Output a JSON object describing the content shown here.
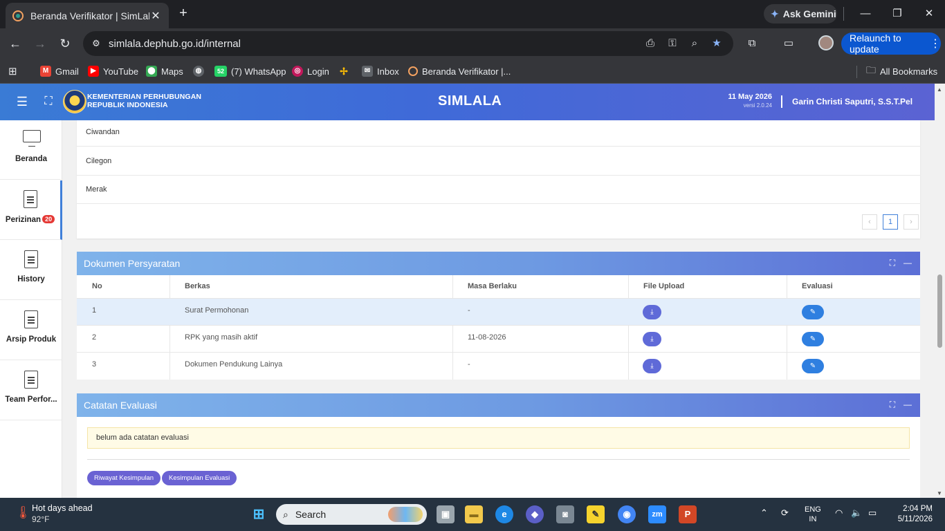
{
  "browser": {
    "tab_title": "Beranda Verifikator | SimLala",
    "url": "simlala.dephub.go.id/internal",
    "ask_gemini": "Ask Gemini",
    "relaunch": "Relaunch to update",
    "all_bookmarks": "All Bookmarks",
    "bookmarks": [
      {
        "label": "Gmail"
      },
      {
        "label": "YouTube"
      },
      {
        "label": "Maps"
      },
      {
        "label": ""
      },
      {
        "label": "(7) WhatsApp",
        "badge": "52"
      },
      {
        "label": "Login"
      },
      {
        "label": ""
      },
      {
        "label": "Inbox"
      },
      {
        "label": "Beranda Verifikator |..."
      }
    ]
  },
  "header": {
    "org_line1": "KEMENTERIAN PERHUBUNGAN",
    "org_line2": "REPUBLIK INDONESIA",
    "app_title": "SIMLALA",
    "date": "11 May 2026",
    "version": "versi 2.0.24",
    "user": "Garin Christi Saputri, S.S.T.Pel"
  },
  "sidebar": {
    "items": [
      {
        "label": "Beranda"
      },
      {
        "label": "Perizinan",
        "badge": "20"
      },
      {
        "label": "History"
      },
      {
        "label": "Arsip Produk"
      },
      {
        "label": "Team Perfor..."
      }
    ]
  },
  "locations": {
    "rows": [
      "Ciwandan",
      "Cilegon",
      "Merak"
    ],
    "pagination": {
      "prev": "‹",
      "current": "1",
      "next": "›"
    }
  },
  "dokumen": {
    "title": "Dokumen Persyaratan",
    "columns": {
      "no": "No",
      "berkas": "Berkas",
      "masa": "Masa Berlaku",
      "file": "File Upload",
      "evaluasi": "Evaluasi"
    },
    "rows": [
      {
        "no": "1",
        "berkas": "Surat Permohonan",
        "masa": "-"
      },
      {
        "no": "2",
        "berkas": "RPK yang masih aktif",
        "masa": "11-08-2026"
      },
      {
        "no": "3",
        "berkas": "Dokumen Pendukung Lainya",
        "masa": "-"
      }
    ]
  },
  "catatan": {
    "title": "Catatan Evaluasi",
    "notice": "belum ada catatan evaluasi",
    "btn_riwayat": "Riwayat Kesimpulan",
    "btn_kesimpulan": "Kesimpulan Evaluasi"
  },
  "taskbar": {
    "weather_title": "Hot days ahead",
    "weather_temp": "92°F",
    "search": "Search",
    "lang_line1": "ENG",
    "lang_line2": "IN",
    "time": "2:04 PM",
    "date": "5/11/2026"
  },
  "colors": {
    "header_blue": "#3f6ad8",
    "accent_purple": "#5f6ad8",
    "evaluasi_blue": "#2f7fe0",
    "badge_red": "#e53935"
  }
}
